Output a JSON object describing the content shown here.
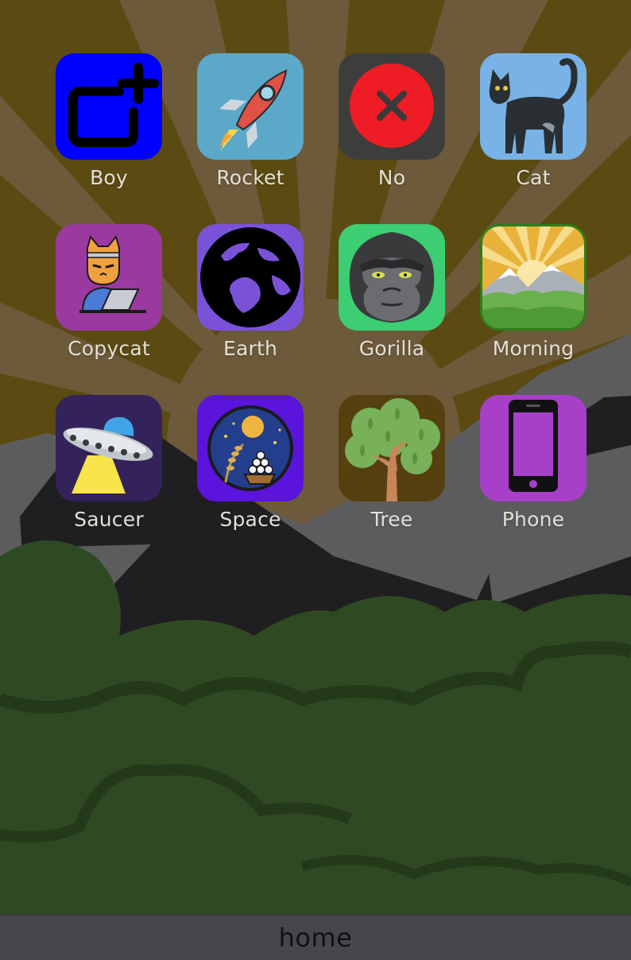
{
  "home_screen": {
    "apps": [
      {
        "label": "Boy",
        "icon": "new-window-plus-icon",
        "bg": "#0000ff"
      },
      {
        "label": "Rocket",
        "icon": "rocket-icon",
        "bg": "#5ba8c8"
      },
      {
        "label": "No",
        "icon": "cross-mark-icon",
        "bg": "#3d3d3d"
      },
      {
        "label": "Cat",
        "icon": "black-cat-icon",
        "bg": "#78b2e6"
      },
      {
        "label": "Copycat",
        "icon": "cat-laptop-icon",
        "bg": "#9a3aa0"
      },
      {
        "label": "Earth",
        "icon": "earth-globe-icon",
        "bg": "#7a52d8"
      },
      {
        "label": "Gorilla",
        "icon": "gorilla-icon",
        "bg": "#3dcd72"
      },
      {
        "label": "Morning",
        "icon": "sunrise-mountain-icon",
        "bg": "#e8b23a"
      },
      {
        "label": "Saucer",
        "icon": "flying-saucer-icon",
        "bg": "#33235a"
      },
      {
        "label": "Space",
        "icon": "moon-viewing-icon",
        "bg": "#5a14dc"
      },
      {
        "label": "Tree",
        "icon": "deciduous-tree-icon",
        "bg": "#56400f"
      },
      {
        "label": "Phone",
        "icon": "mobile-phone-icon",
        "bg": "#a83fc8"
      }
    ]
  },
  "dock": {
    "home_label": "home"
  },
  "colors": {
    "sky": "#5b4a12",
    "rays": "#6c5a3a",
    "mountain": "#1f1f21",
    "forest": "#2f4a22",
    "dock": "#47464c"
  }
}
